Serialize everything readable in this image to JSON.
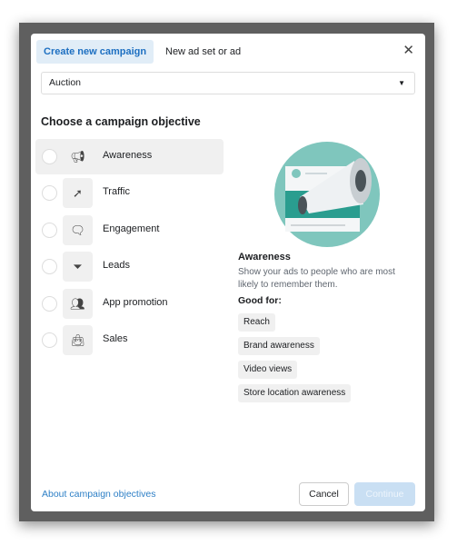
{
  "tabs": [
    {
      "label": "Create new campaign",
      "active": true
    },
    {
      "label": "New ad set or ad",
      "active": false
    }
  ],
  "buying_type": {
    "value": "Auction"
  },
  "heading": "Choose a campaign objective",
  "objectives": [
    {
      "label": "Awareness",
      "icon": "megaphone-icon",
      "selected": true
    },
    {
      "label": "Traffic",
      "icon": "cursor-icon",
      "selected": false
    },
    {
      "label": "Engagement",
      "icon": "chat-bubbles-icon",
      "selected": false
    },
    {
      "label": "Leads",
      "icon": "funnel-icon",
      "selected": false
    },
    {
      "label": "App promotion",
      "icon": "people-icon",
      "selected": false
    },
    {
      "label": "Sales",
      "icon": "shopping-bag-icon",
      "selected": false
    }
  ],
  "detail": {
    "title": "Awareness",
    "description": "Show your ads to people who are most likely to remember them.",
    "good_for_label": "Good for:",
    "good_for": [
      "Reach",
      "Brand awareness",
      "Video views",
      "Store location awareness"
    ]
  },
  "footer": {
    "link": "About campaign objectives",
    "cancel": "Cancel",
    "continue": "Continue"
  },
  "colors": {
    "accent": "#1d6fc1",
    "illustration": "#7fc6bd"
  }
}
